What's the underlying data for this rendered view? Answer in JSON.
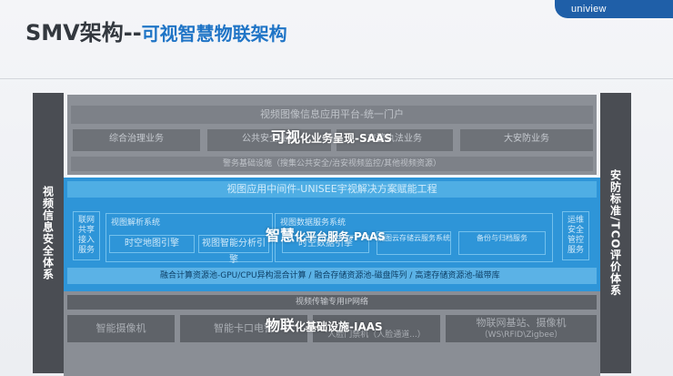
{
  "brand": "uniview",
  "title": {
    "main": "SMV架构",
    "dash": "--",
    "sub": "可视智慧物联架构"
  },
  "left_side": "视频信息安全体系",
  "right_side": "安防标准/TCO评价体系",
  "saas": {
    "top_bar": "视频图像信息应用平台-统一门户",
    "apps": [
      "综合治理业务",
      "公共安全业务",
      "交警执法业务",
      "大安防业务"
    ],
    "bottom_bar": "警务基础设施（搜集公共安全/治安视频监控/其他视频资源）",
    "overlay_main": "可视",
    "overlay_rest": "化业务呈现-SAAS"
  },
  "paas": {
    "head": "视图应用中间件-UNISEE宇视解决方案赋能工程",
    "left_col": [
      "联网",
      "共享",
      "接入",
      "服务"
    ],
    "group1_title": "视图解析系统",
    "group1_items": [
      "时空地图引擎",
      "视图智能分析引擎"
    ],
    "group2_title": "视图数据服务系统",
    "group2_items": [
      "时空数据引擎",
      "视图云存储云服务系统",
      "备份与归档服务"
    ],
    "right_col": [
      "运维",
      "安全",
      "管控",
      "服务"
    ],
    "bottom": "融合计算资源池-GPU/CPU异构混合计算 / 融合存储资源池-磁盘阵列 / 高速存储资源池-磁带库",
    "overlay_main": "智慧",
    "overlay_rest": "化平台服务-PAAS"
  },
  "iaas": {
    "bar": "视频传输专用IP网络",
    "devices": [
      "智能摄像机",
      "智能卡口电警",
      "人脸门禁机（人脸通道...）",
      "物联网基站、摄像机"
    ],
    "device_note": "（WS\\RFID\\Zigbee）",
    "overlay_main": "物联",
    "overlay_rest": "化基础设施-IAAS"
  },
  "colors": {
    "brand": "#1f5fa8",
    "accent": "#1f74c6",
    "paas": "#2e95d8",
    "side": "#4a4d53"
  }
}
